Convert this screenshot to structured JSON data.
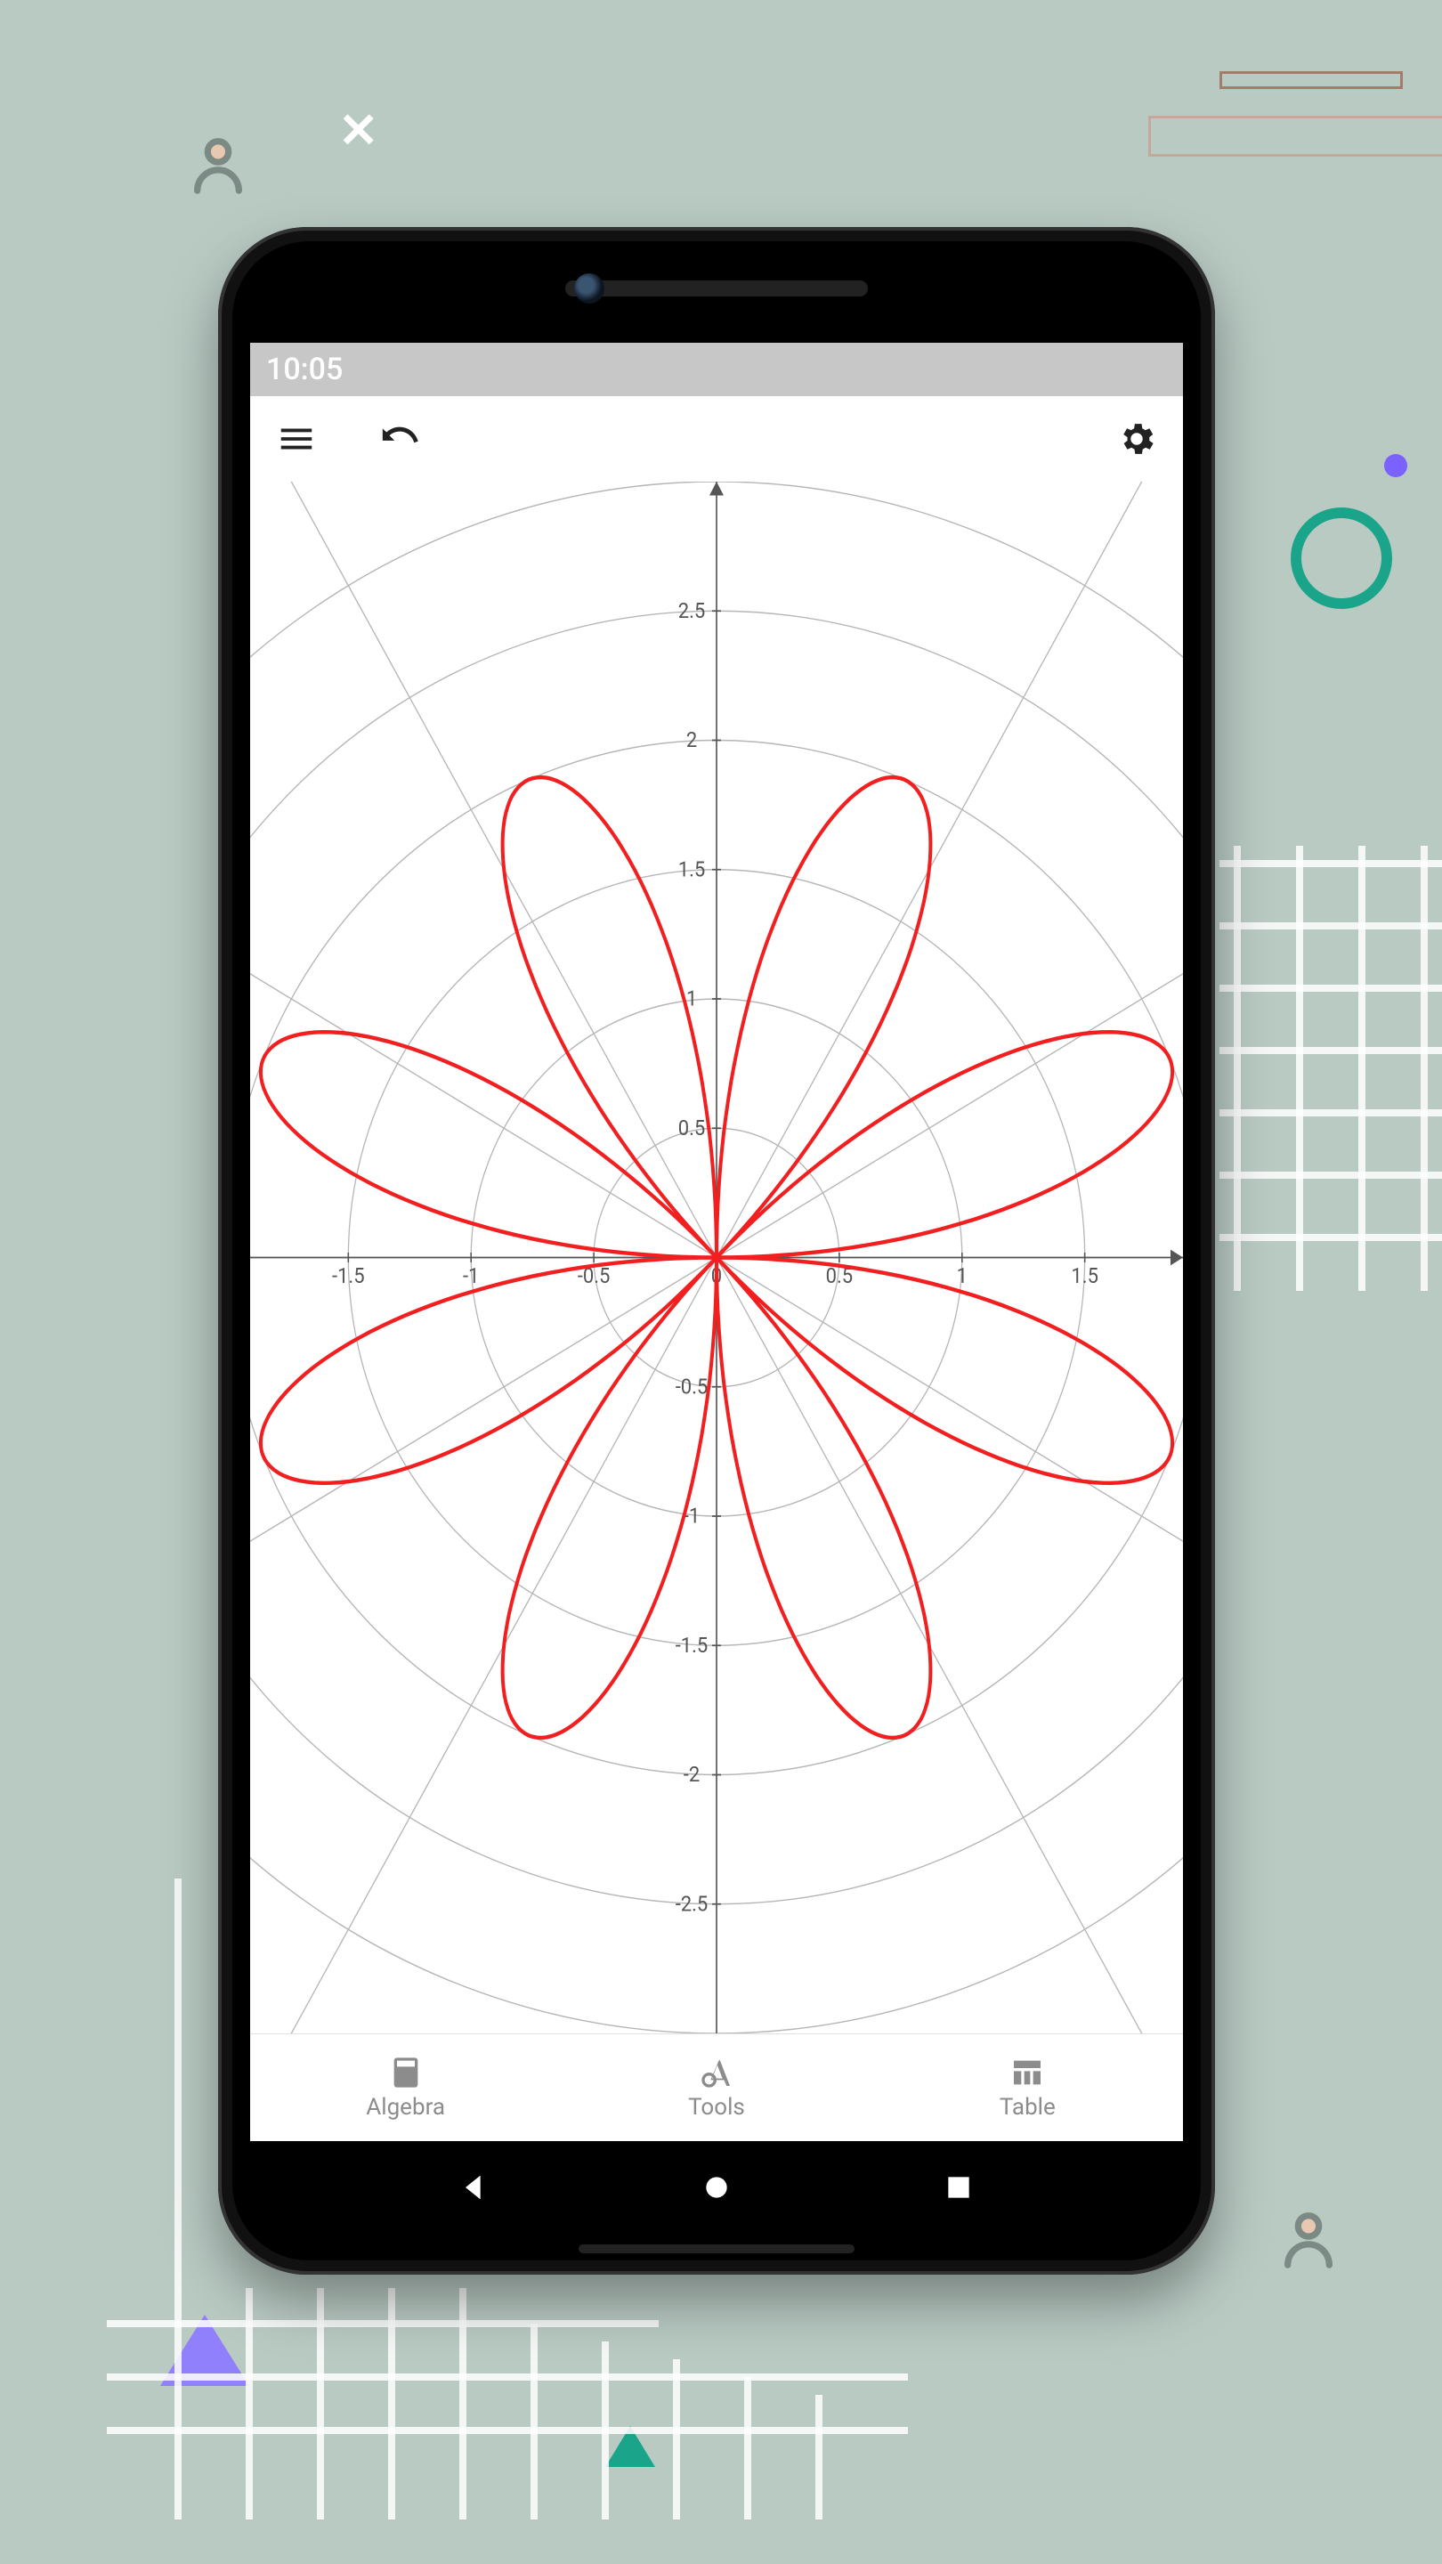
{
  "statusbar": {
    "time": "10:05"
  },
  "bottomnav": {
    "algebra": "Algebra",
    "tools": "Tools",
    "table": "Table"
  },
  "chart_data": {
    "type": "polar-rose",
    "equation_implied": "r = 2·sin(4θ)",
    "petals": 8,
    "amplitude": 2,
    "r_grid_circles": [
      0.5,
      1,
      1.5,
      2,
      2.5,
      3
    ],
    "radial_lines_deg": [
      0,
      30,
      60,
      90,
      120,
      150
    ],
    "x_ticks": [
      -1.5,
      -1,
      -0.5,
      0,
      0.5,
      1,
      1.5
    ],
    "y_ticks": [
      -2.5,
      -2,
      -1.5,
      -1,
      -0.5,
      0.5,
      1,
      1.5,
      2,
      2.5
    ],
    "x_range": [
      -1.9,
      1.9
    ],
    "y_range": [
      -3.0,
      3.0
    ],
    "curve_color": "#f11f1f"
  }
}
